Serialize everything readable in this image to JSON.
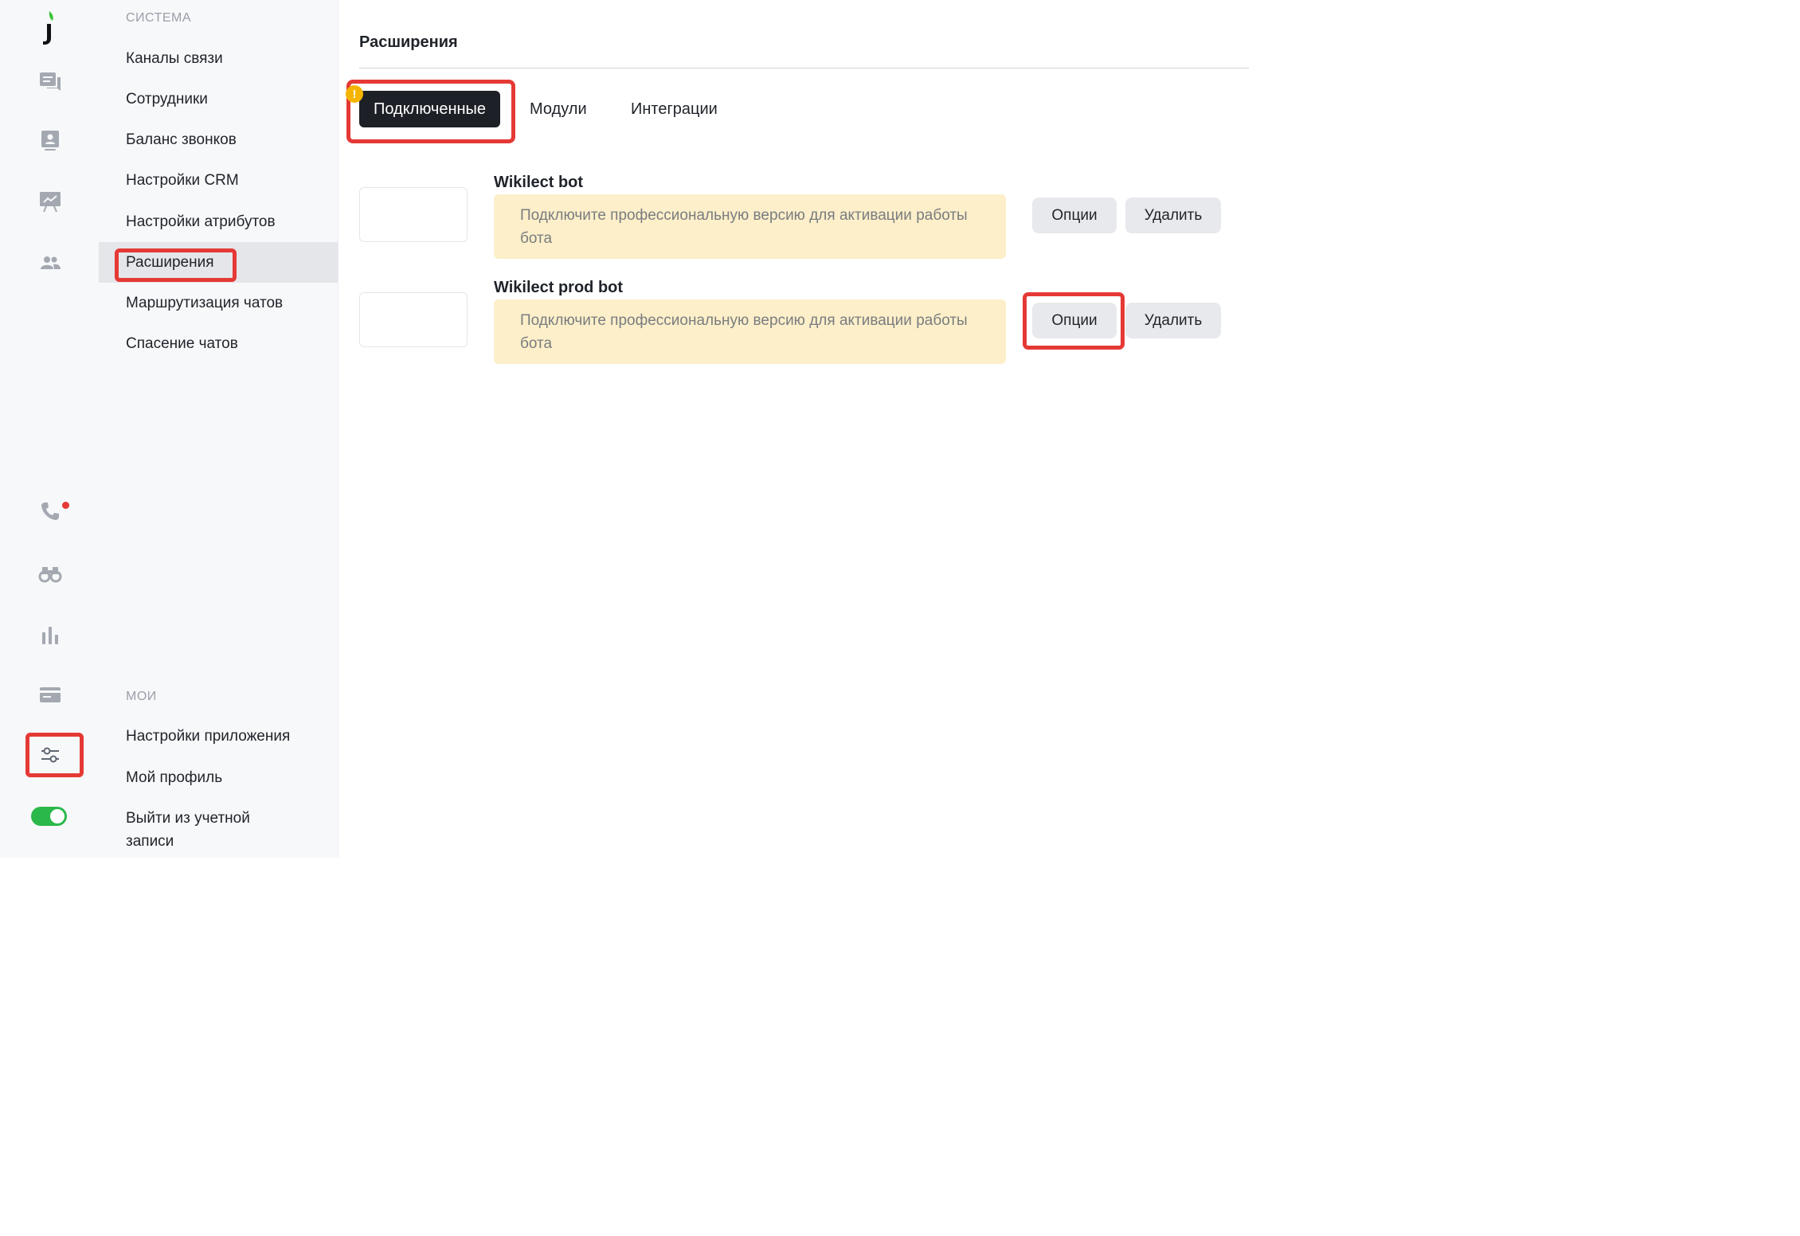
{
  "rail": {
    "icons": [
      "logo-icon",
      "chat-icon",
      "contacts-icon",
      "presentation-icon",
      "team-icon",
      "phone-icon",
      "binoculars-icon",
      "stats-icon",
      "card-icon",
      "settings-sliders-icon"
    ],
    "toggle_on": true,
    "accent": "#2bb84a",
    "notification_color": "#e53935"
  },
  "menu": {
    "system_section": "СИСТЕМА",
    "system_items": [
      "Каналы связи",
      "Сотрудники",
      "Баланс звонков",
      "Настройки CRM",
      "Настройки атрибутов",
      "Расширения",
      "Маршрутизация чатов",
      "Спасение чатов"
    ],
    "active_item": "Расширения",
    "my_section": "МОИ",
    "my_items": [
      "Настройки приложения",
      "Мой профиль",
      "Выйти из учетной записи"
    ]
  },
  "main": {
    "title": "Расширения",
    "tabs": [
      {
        "label": "Подключенные",
        "active": true
      },
      {
        "label": "Модули",
        "active": false
      },
      {
        "label": "Интеграции",
        "active": false
      }
    ],
    "warning_badge": "!",
    "extensions": [
      {
        "name": "Wikilect bot",
        "note": "Подключите профессиональную версию для активации работы бота",
        "options_label": "Опции",
        "delete_label": "Удалить"
      },
      {
        "name": "Wikilect prod bot",
        "note": "Подключите профессиональную версию для активации работы бота",
        "options_label": "Опции",
        "delete_label": "Удалить"
      }
    ],
    "highlight_color": "#e53935",
    "note_background": "#fcefc9"
  }
}
